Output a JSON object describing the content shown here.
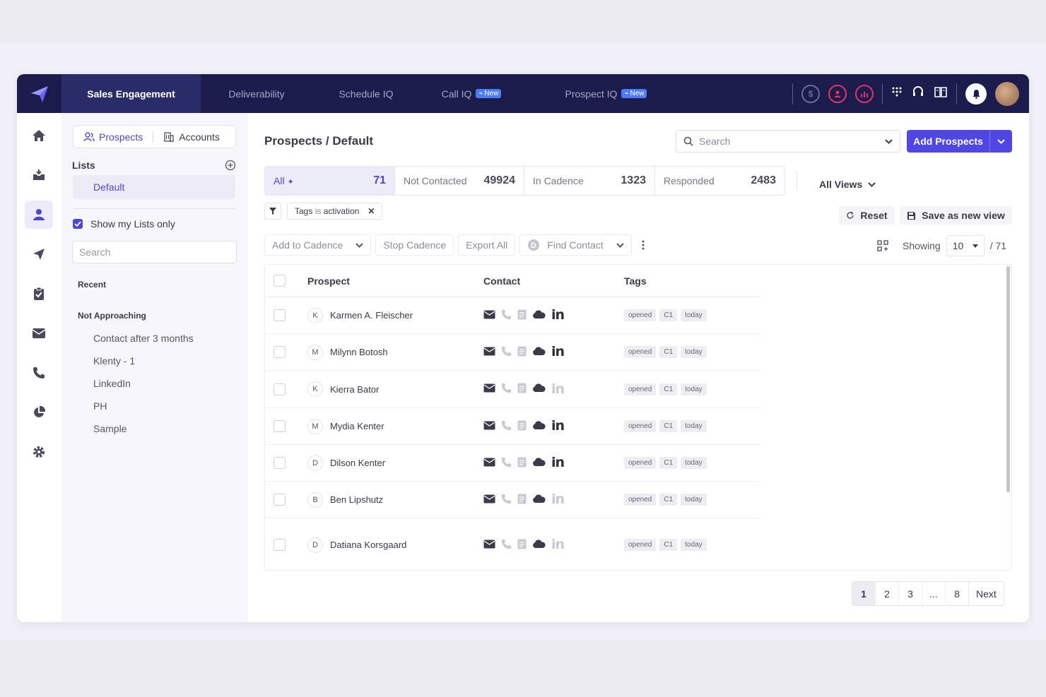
{
  "nav": {
    "tabs": [
      {
        "label": "Sales Engagement",
        "badge": ""
      },
      {
        "label": "Deliverability",
        "badge": ""
      },
      {
        "label": "Schedule IQ",
        "badge": ""
      },
      {
        "label": "Call IQ",
        "badge": "New"
      },
      {
        "label": "Prospect IQ",
        "badge": "New"
      }
    ],
    "accent": "#1b1c4b"
  },
  "sidebar": {
    "tabs": {
      "prospects": "Prospects",
      "accounts": "Accounts"
    },
    "lists_heading": "Lists",
    "default_list": "Default",
    "show_my_lists": "Show my Lists only",
    "search_placeholder": "Search",
    "recent_heading": "Recent",
    "group_heading": "Not Approaching",
    "items": [
      "Contact after 3 months",
      "Klenty - 1",
      "LinkedIn",
      "PH",
      "Sample"
    ]
  },
  "main": {
    "title": "Prospects / Default",
    "search_placeholder": "Search",
    "add_button": "Add Prospects",
    "stats": [
      {
        "label": "All",
        "value": "71"
      },
      {
        "label": "Not Contacted",
        "value": "49924"
      },
      {
        "label": "In Cadence",
        "value": "1323"
      },
      {
        "label": "Responded",
        "value": "2483"
      }
    ],
    "all_views": "All Views",
    "filter": {
      "field": "Tags",
      "op": "is",
      "value": "activation"
    },
    "reset": "Reset",
    "save_view": "Save as new view",
    "actions": {
      "add_to_cadence": "Add to Cadence",
      "stop_cadence": "Stop Cadence",
      "export_all": "Export All",
      "find_contact": "Find Contact"
    },
    "showing_label": "Showing",
    "page_size": "10",
    "total": "/ 71",
    "columns": {
      "prospect": "Prospect",
      "contact": "Contact",
      "tags": "Tags"
    },
    "rows": [
      {
        "initial": "K",
        "name": "Karmen A. Fleischer",
        "linkedin": true,
        "tags": [
          "opened",
          "C1",
          "today"
        ]
      },
      {
        "initial": "M",
        "name": "Milynn Botosh",
        "linkedin": true,
        "tags": [
          "opened",
          "C1",
          "today"
        ]
      },
      {
        "initial": "K",
        "name": "Kierra Bator",
        "linkedin": false,
        "tags": [
          "opened",
          "C1",
          "today"
        ]
      },
      {
        "initial": "M",
        "name": "Mydia Kenter",
        "linkedin": true,
        "tags": [
          "opened",
          "C1",
          "today"
        ]
      },
      {
        "initial": "D",
        "name": "Dilson Kenter",
        "linkedin": true,
        "tags": [
          "opened",
          "C1",
          "today"
        ]
      },
      {
        "initial": "B",
        "name": "Ben Lipshutz",
        "linkedin": false,
        "tags": [
          "opened",
          "C1",
          "today"
        ]
      },
      {
        "initial": "D",
        "name": "Datiana Korsgaard",
        "linkedin": false,
        "tags": [
          "opened",
          "C1",
          "today"
        ]
      }
    ],
    "pagination": [
      "1",
      "2",
      "3",
      "...",
      "8",
      "Next"
    ]
  }
}
